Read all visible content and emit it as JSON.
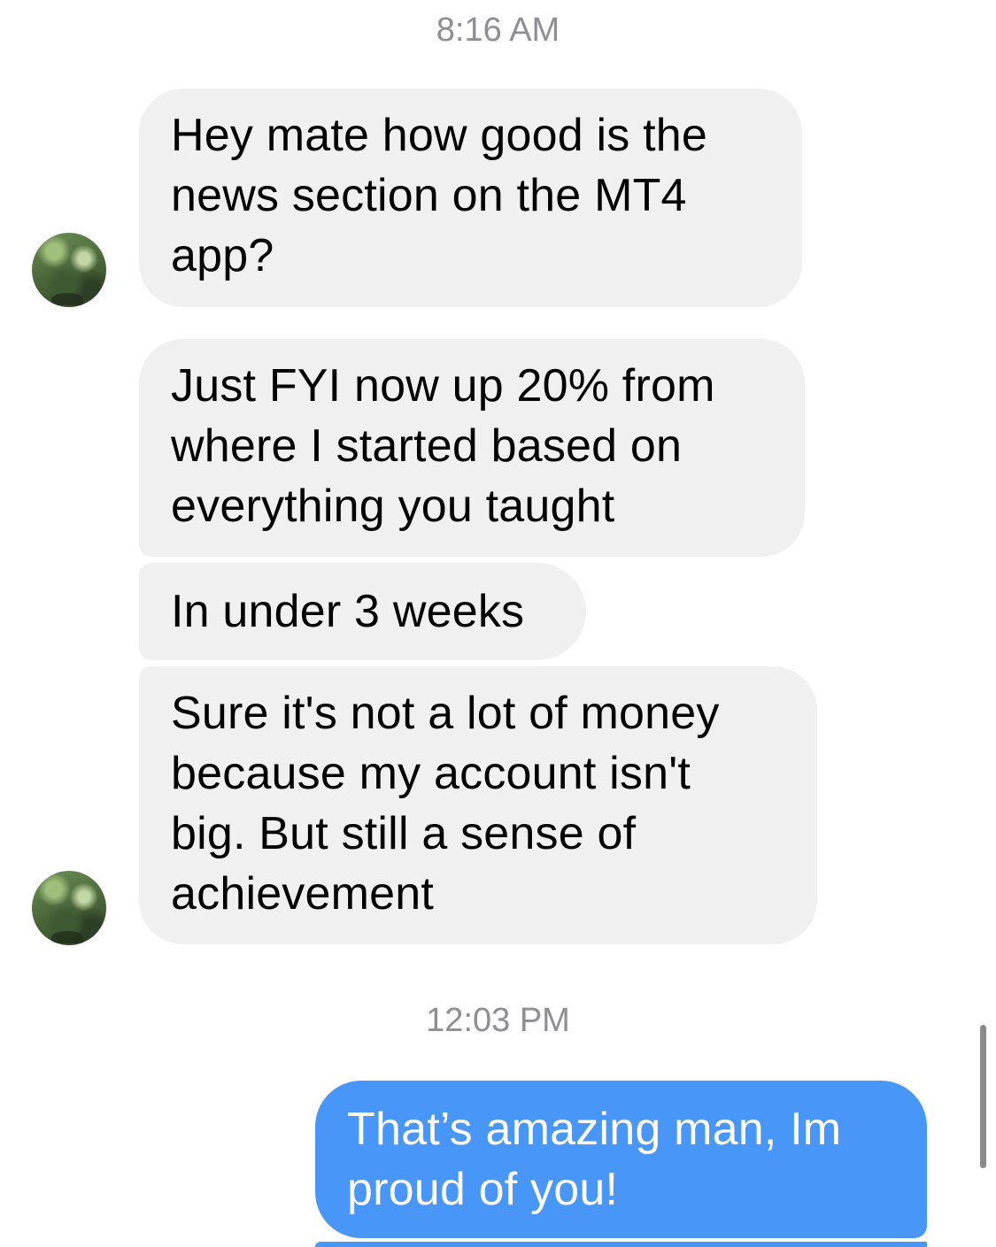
{
  "conversation": {
    "groups": [
      {
        "timestamp": "8:16 AM",
        "messages": [
          {
            "text": "Hey mate how good is the\nnews section on the MT4\napp?"
          },
          {
            "text": "Just FYI now up 20% from\nwhere I started based on\neverything you taught"
          },
          {
            "text": "In under 3 weeks"
          },
          {
            "text": "Sure it's not a lot of money\nbecause my account isn't\nbig. But still a sense of\nachievement"
          }
        ]
      },
      {
        "timestamp": "12:03 PM",
        "messages": [
          {
            "text": "That’s amazing man, Im\nproud of you!"
          }
        ]
      }
    ]
  },
  "colors": {
    "incoming_bubble": "#f0f0f0",
    "outgoing_bubble": "#4896f8",
    "timestamp_text": "#8e8e93"
  }
}
